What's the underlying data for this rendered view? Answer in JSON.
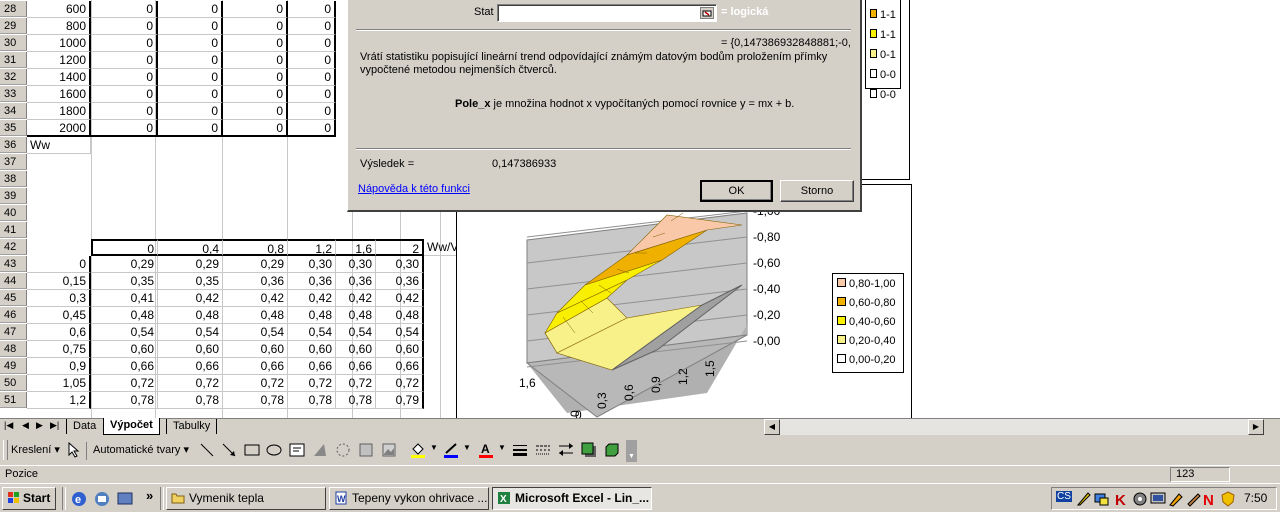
{
  "sheet": {
    "upper_rows": [
      {
        "n": "28",
        "vals": [
          "600",
          "0",
          "0",
          "0",
          "0"
        ]
      },
      {
        "n": "29",
        "vals": [
          "800",
          "0",
          "0",
          "0",
          "0"
        ]
      },
      {
        "n": "30",
        "vals": [
          "1000",
          "0",
          "0",
          "0",
          "0"
        ]
      },
      {
        "n": "31",
        "vals": [
          "1200",
          "0",
          "0",
          "0",
          "0"
        ]
      },
      {
        "n": "32",
        "vals": [
          "1400",
          "0",
          "0",
          "0",
          "0"
        ]
      },
      {
        "n": "33",
        "vals": [
          "1600",
          "0",
          "0",
          "0",
          "0"
        ]
      },
      {
        "n": "34",
        "vals": [
          "1800",
          "0",
          "0",
          "0",
          "0"
        ]
      },
      {
        "n": "35",
        "vals": [
          "2000",
          "0",
          "0",
          "0",
          "0"
        ]
      }
    ],
    "row36_label": "Ww",
    "empty_rows": [
      "36",
      "37",
      "38",
      "39",
      "40",
      "41"
    ],
    "row42": {
      "n": "42",
      "vals": [
        "0",
        "0,4",
        "0,8",
        "1,2",
        "1,6",
        "2"
      ],
      "tail": "Ww/V"
    },
    "lower_rows": [
      {
        "n": "43",
        "vals": [
          "0",
          "0,29",
          "0,29",
          "0,29",
          "0,30",
          "0,30",
          "0,30"
        ]
      },
      {
        "n": "44",
        "vals": [
          "0,15",
          "0,35",
          "0,35",
          "0,36",
          "0,36",
          "0,36",
          "0,36"
        ]
      },
      {
        "n": "45",
        "vals": [
          "0,3",
          "0,41",
          "0,42",
          "0,42",
          "0,42",
          "0,42",
          "0,42"
        ]
      },
      {
        "n": "46",
        "vals": [
          "0,45",
          "0,48",
          "0,48",
          "0,48",
          "0,48",
          "0,48",
          "0,48"
        ]
      },
      {
        "n": "47",
        "vals": [
          "0,6",
          "0,54",
          "0,54",
          "0,54",
          "0,54",
          "0,54",
          "0,54"
        ]
      },
      {
        "n": "48",
        "vals": [
          "0,75",
          "0,60",
          "0,60",
          "0,60",
          "0,60",
          "0,60",
          "0,60"
        ]
      },
      {
        "n": "49",
        "vals": [
          "0,9",
          "0,66",
          "0,66",
          "0,66",
          "0,66",
          "0,66",
          "0,66"
        ]
      },
      {
        "n": "50",
        "vals": [
          "1,05",
          "0,72",
          "0,72",
          "0,72",
          "0,72",
          "0,72",
          "0,72"
        ]
      },
      {
        "n": "51",
        "vals": [
          "1,2",
          "0,78",
          "0,78",
          "0,78",
          "0,78",
          "0,78",
          "0,79"
        ]
      }
    ]
  },
  "dialog": {
    "stat_label": "Stat",
    "stat_value": "",
    "stat_result": "= logická",
    "formula_result": "= {0,147386932848881;-0,",
    "description": "Vrátí statistiku popisující lineární trend odpovídající známým datovým bodům proložením přímky vypočtené metodou nejmenších čtverců.",
    "param_name": "Pole_x",
    "param_desc": "je množina hodnot x vypočítaných pomocí rovnice y = mx + b.",
    "result_label": "Výsledek =",
    "result_value": "0,147386933",
    "help_link": "Nápověda k této funkci",
    "ok_label": "OK",
    "cancel_label": "Storno"
  },
  "top_chart_legend": [
    "1-1",
    "1-1",
    "0-1",
    "0-0",
    "0-0"
  ],
  "chart_data": {
    "type": "surface",
    "legend": [
      "0,80-1,00",
      "0,60-0,80",
      "0,40-0,60",
      "0,20-0,40",
      "0,00-0,20"
    ],
    "legend_colors": [
      "#f8c8a8",
      "#f0b000",
      "#f8f000",
      "#f8f088",
      "#ffffff"
    ],
    "z_ticks": [
      "0,00",
      "0,20",
      "0,40",
      "0,60",
      "0,80",
      "1,00"
    ],
    "x_ticks": [
      "0",
      "0,3",
      "0,6",
      "0,9",
      "1,2",
      "1,5"
    ],
    "y_ticks": [
      "1,6",
      "0"
    ]
  },
  "tabs": {
    "items": [
      "Data",
      "Výpočet",
      "Tabulky"
    ],
    "active": "Výpočet"
  },
  "drawbar": {
    "draw_label": "Kreslení ▾",
    "autoshapes_label": "Automatické tvary ▾"
  },
  "status": {
    "left": "Pozice",
    "num": "123"
  },
  "taskbar": {
    "start": "Start",
    "chevron": "»",
    "buttons": [
      "Vymenik tepla",
      "Tepeny vykon ohrivace ...",
      "Microsoft Excel - Lin_..."
    ],
    "active_index": 2,
    "clock": "7:50",
    "tray_cs": "CS"
  },
  "colors": {
    "win_gray": "#d4d0c8",
    "highlight": "#0a246a",
    "link": "#0000ff"
  }
}
